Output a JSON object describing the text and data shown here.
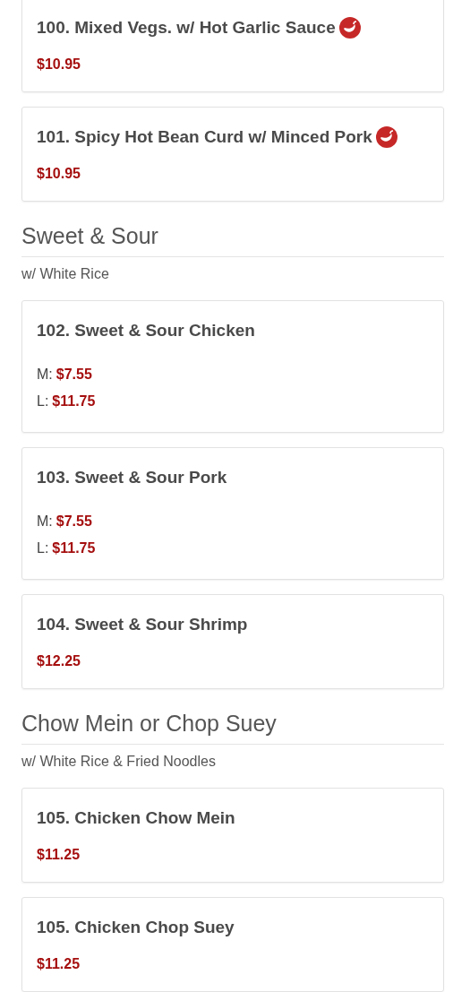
{
  "sections": [
    {
      "items": [
        {
          "name": "100. Mixed Vegs. w/ Hot Garlic Sauce",
          "spicy": true,
          "prices": [
            {
              "price": "$10.95"
            }
          ]
        },
        {
          "name": "101. Spicy Hot Bean Curd w/ Minced Pork",
          "spicy": true,
          "prices": [
            {
              "price": "$10.95"
            }
          ]
        }
      ]
    },
    {
      "title": "Sweet & Sour",
      "subtitle": "w/ White Rice",
      "items": [
        {
          "name": "102. Sweet & Sour Chicken",
          "spicy": false,
          "prices": [
            {
              "size": "M:",
              "price": "$7.55"
            },
            {
              "size": "L:",
              "price": "$11.75"
            }
          ]
        },
        {
          "name": "103. Sweet & Sour Pork",
          "spicy": false,
          "prices": [
            {
              "size": "M:",
              "price": "$7.55"
            },
            {
              "size": "L:",
              "price": "$11.75"
            }
          ]
        },
        {
          "name": "104. Sweet & Sour Shrimp",
          "spicy": false,
          "prices": [
            {
              "price": "$12.25"
            }
          ]
        }
      ]
    },
    {
      "title": "Chow Mein or Chop Suey",
      "subtitle": "w/ White Rice & Fried Noodles",
      "items": [
        {
          "name": "105. Chicken Chow Mein",
          "spicy": false,
          "prices": [
            {
              "price": "$11.25"
            }
          ]
        },
        {
          "name": "105. Chicken Chop Suey",
          "spicy": false,
          "prices": [
            {
              "price": "$11.25"
            }
          ]
        }
      ]
    }
  ]
}
